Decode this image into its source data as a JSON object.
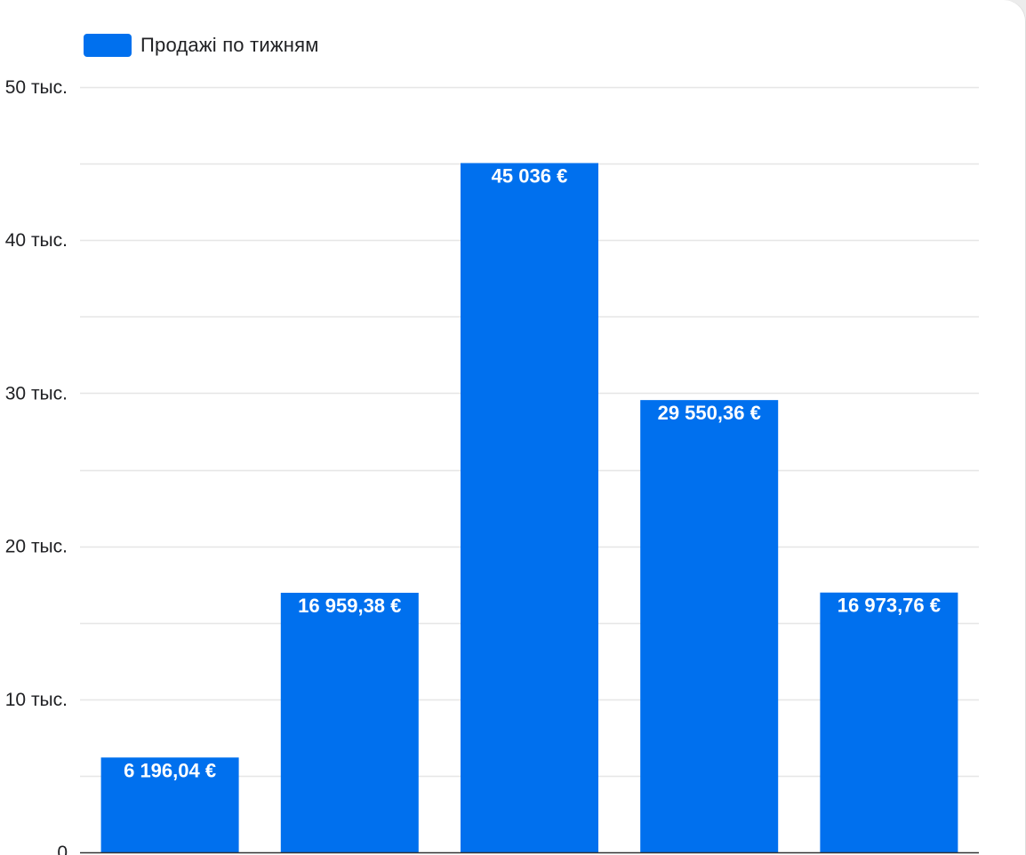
{
  "chart_data": {
    "type": "bar",
    "categories": [
      "",
      "",
      "",
      "",
      ""
    ],
    "series": [
      {
        "name": "Продажі по тижням",
        "values": [
          6196.04,
          16959.38,
          45036,
          29550.36,
          16973.76
        ],
        "labels": [
          "6 196,04 €",
          "16 959,38 €",
          "45 036 €",
          "29 550,36 €",
          "16 973,76 €"
        ],
        "color": "#0070ee"
      }
    ],
    "title": "",
    "xlabel": "",
    "ylabel": "",
    "ylim": [
      0,
      50000
    ],
    "y_ticks": [
      {
        "value": 0,
        "label": "0"
      },
      {
        "value": 10000,
        "label": "10 тыс."
      },
      {
        "value": 20000,
        "label": "20 тыс."
      },
      {
        "value": 30000,
        "label": "30 тыс."
      },
      {
        "value": 40000,
        "label": "40 тыс."
      },
      {
        "value": 50000,
        "label": "50 тыс."
      }
    ],
    "minor_grid_step": 5000,
    "grid": true,
    "legend_position": "top-left",
    "colors": {
      "grid": "#e6e6e6",
      "axis": "#333333"
    }
  }
}
